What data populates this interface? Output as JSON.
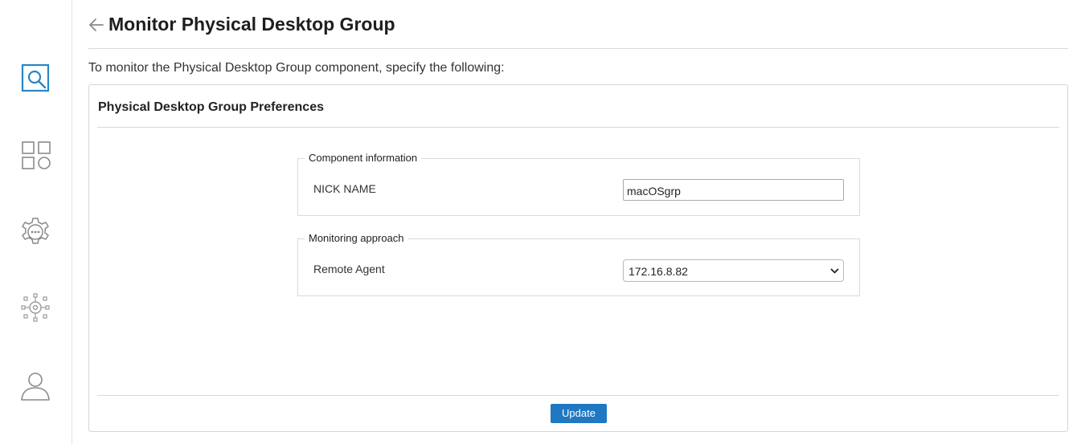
{
  "header": {
    "title": "Monitor Physical Desktop Group",
    "back_icon": "arrow-left-icon"
  },
  "intro": "To monitor the Physical Desktop Group component, specify the following:",
  "sidebar": {
    "items": [
      {
        "icon": "monitor-search-icon",
        "active": true
      },
      {
        "icon": "components-icon",
        "active": false
      },
      {
        "icon": "settings-gear-icon",
        "active": false
      },
      {
        "icon": "integration-hub-icon",
        "active": false
      },
      {
        "icon": "user-profile-icon",
        "active": false
      }
    ]
  },
  "panel": {
    "title": "Physical Desktop Group Preferences",
    "component_info": {
      "legend": "Component information",
      "nickname_label": "NICK NAME",
      "nickname_value": "macOSgrp"
    },
    "monitoring": {
      "legend": "Monitoring approach",
      "remote_agent_label": "Remote Agent",
      "remote_agent_value": "172.16.8.82"
    },
    "update_label": "Update"
  },
  "colors": {
    "accent": "#1f78c1",
    "active_icon": "#2a86c6",
    "inactive_icon": "#8a8a8a"
  }
}
